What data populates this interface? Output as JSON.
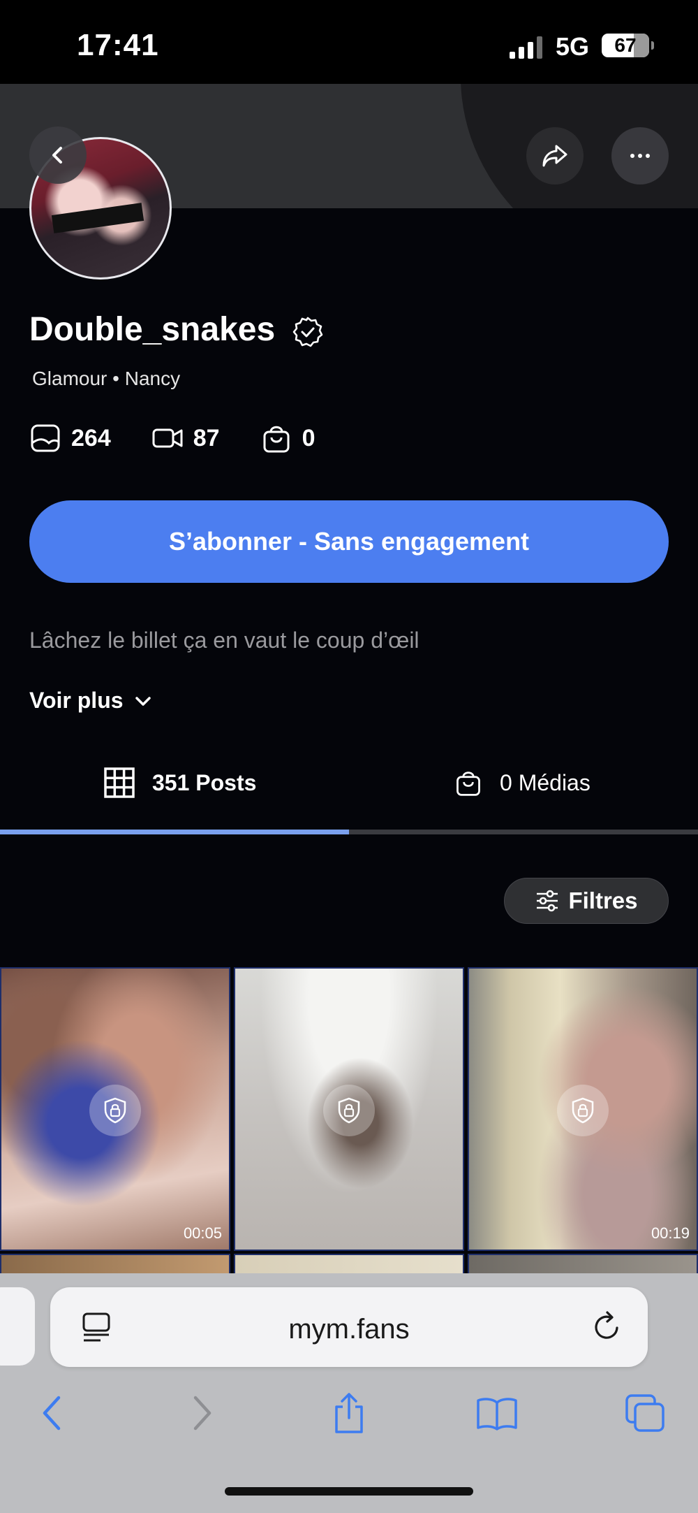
{
  "status": {
    "time": "17:41",
    "network": "5G",
    "battery": "67"
  },
  "profile": {
    "username": "Double_snakes",
    "subtitle": "Glamour • Nancy",
    "stats": {
      "photos": "264",
      "videos": "87",
      "shop": "0"
    },
    "bio": "Lâchez le billet ça en vaut le coup d’œil",
    "see_more": "Voir plus"
  },
  "subscribe_label": "S’abonner - Sans engagement",
  "tabs": {
    "posts": "351 Posts",
    "media": "0 Médias",
    "active": "posts",
    "indicator_fraction": 0.5
  },
  "filter_label": "Filtres",
  "tiles": [
    {
      "duration": "00:05"
    },
    {
      "duration": ""
    },
    {
      "duration": "00:19"
    }
  ],
  "browser": {
    "url": "mym.fans"
  },
  "colors": {
    "accent": "#4c7ef0",
    "background": "#04050a",
    "tab_indicator": "#7aa0ee"
  }
}
